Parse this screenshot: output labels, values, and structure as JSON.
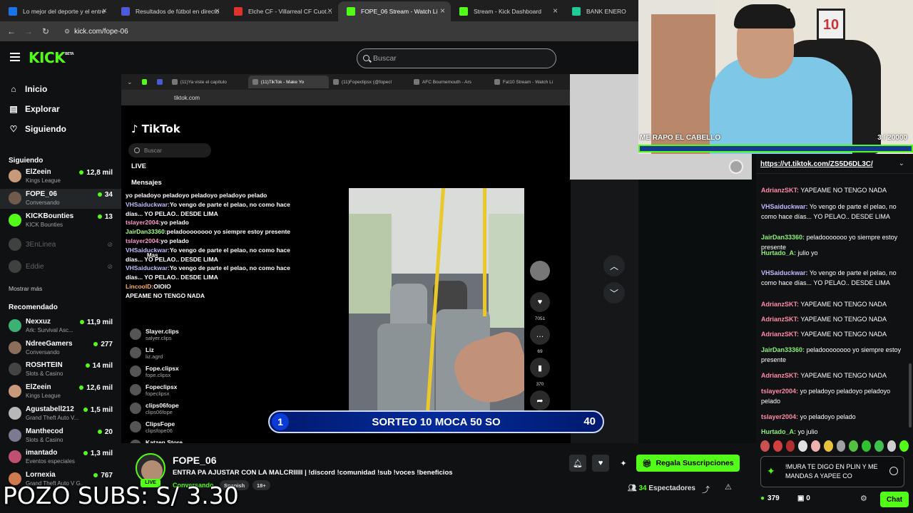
{
  "browser_tabs": [
    {
      "label": "Lo mejor del deporte y el entre",
      "color": "#1a73e8"
    },
    {
      "label": "Resultados de fútbol en directo",
      "color": "#4a5bd4"
    },
    {
      "label": "Elche CF - Villarreal CF Cuotas",
      "color": "#e03131"
    },
    {
      "label": "FOPE_06 Stream - Watch Li",
      "color": "#53fc18"
    },
    {
      "label": "Stream - Kick Dashboard",
      "color": "#53fc18"
    },
    {
      "label": "BANK ENERO",
      "color": "#20c997"
    }
  ],
  "address": "kick.com/fope-06",
  "kick": {
    "logo": "KICK",
    "beta": "BETA",
    "search_placeholder": "Buscar"
  },
  "nav": [
    {
      "label": "Inicio",
      "icon": "home-icon",
      "glyph": "⌂"
    },
    {
      "label": "Explorar",
      "icon": "browse-icon",
      "glyph": "▤"
    },
    {
      "label": "Siguiendo",
      "icon": "heart-icon",
      "glyph": "♡"
    }
  ],
  "following_heading": "Siguiendo",
  "following": [
    {
      "name": "ElZeein",
      "category": "Kings League",
      "viewers": "12,8 mil",
      "color": "#c79a7b"
    },
    {
      "name": "FOPE_06",
      "category": "Conversando",
      "viewers": "34",
      "color": "#6f5a4b"
    },
    {
      "name": "KICKBounties",
      "category": "KICK Bounties",
      "viewers": "13",
      "color": "#53fc18"
    }
  ],
  "offline": [
    {
      "name": "3EnLinea"
    },
    {
      "name": "Eddie"
    }
  ],
  "show_more": "Mostrar más",
  "recommended_heading": "Recomendado",
  "recommended": [
    {
      "name": "Nexxuz",
      "category": "Ark: Survival Asc...",
      "viewers": "11,9 mil",
      "color": "#3bb273"
    },
    {
      "name": "NdreeGamers",
      "category": "Conversando",
      "viewers": "277",
      "color": "#8a6d5a"
    },
    {
      "name": "ROSHTEIN",
      "category": "Slots & Casino",
      "viewers": "14 mil",
      "color": "#444"
    },
    {
      "name": "ElZeein",
      "category": "Kings League",
      "viewers": "12,6 mil",
      "color": "#c79a7b"
    },
    {
      "name": "Agustabell212",
      "category": "Grand Theft Auto V...",
      "viewers": "1,5 mil",
      "color": "#b8b8b8"
    },
    {
      "name": "Manthecod",
      "category": "Slots & Casino",
      "viewers": "20",
      "color": "#7a7a90"
    },
    {
      "name": "imantado",
      "category": "Eventos especiales",
      "viewers": "1,3 mil",
      "color": "#c05070"
    },
    {
      "name": "Lornexia",
      "category": "Grand Theft Auto V G...",
      "viewers": "767",
      "color": "#d07a50"
    }
  ],
  "inner_browser": {
    "tabs": [
      "(11)Ya viste el capítulo",
      "(11)TikTok - Make Yo",
      "(11)Fopeclipsx (@fopecl",
      "AFC Bournemouth - Ars",
      "Fat10 Stream - Watch Li"
    ],
    "address": "tiktok.com"
  },
  "tiktok": {
    "logo": "TikTok",
    "search_placeholder": "Buscar",
    "menu": [
      "LIVE",
      "Mensajes",
      "Mas"
    ],
    "accounts": [
      {
        "name": "Slayer.clips",
        "user": "salyer.clips"
      },
      {
        "name": "Liz",
        "user": "liz.agrd"
      },
      {
        "name": "Fope.clipsx",
        "user": "fope.clipsx"
      },
      {
        "name": "Fopeclipsx",
        "user": "fopeclipsx"
      },
      {
        "name": "clips06fope",
        "user": "clips06fope"
      },
      {
        "name": "ClipsFope",
        "user": "clipsfope06"
      },
      {
        "name": "Katzen Store",
        "user": ""
      }
    ],
    "counts": [
      "7051",
      "69",
      "370",
      "1422"
    ]
  },
  "overlay_chat": [
    {
      "user": "",
      "text": "yo peladoyo peladoyo peladoyo peladoyo pelado",
      "cls": "u1"
    },
    {
      "user": "VHSaiduckwar:",
      "text": "Yo vengo de parte el pelao, no como hace días... YO PELAO.. DESDE LIMA",
      "cls": "u2"
    },
    {
      "user": "tslayer2004:",
      "text": "yo pelado",
      "cls": "u1"
    },
    {
      "user": "JairDan33360:",
      "text": "peladoooooooo yo siempre estoy presente",
      "cls": "u3"
    },
    {
      "user": "tslayer2004:",
      "text": "yo pelado",
      "cls": "u1"
    },
    {
      "user": "VHSaiduckwar:",
      "text": "Yo vengo de parte el pelao, no como hace días... YO PELAO.. DESDE LIMA",
      "cls": "u2"
    },
    {
      "user": "VHSaiduckwar:",
      "text": "Yo vengo de parte el pelao, no como hace días... YO PELAO.. DESDE LIMA",
      "cls": "u2"
    },
    {
      "user": "LincoolD:",
      "text": "OIOIO",
      "cls": "u4"
    },
    {
      "user": "",
      "text": "APEAME NO TENGO NADA",
      "cls": ""
    }
  ],
  "sorteo": {
    "left": "1",
    "text": "SORTEO 10 MOCA 50 SO",
    "right": "40"
  },
  "webcam": {
    "label": "ME RAPO EL CABELLO",
    "goal": "3 / 20000",
    "progress": 0.00015,
    "frame_text": "10"
  },
  "chat": {
    "pinned_link": "https://vt.tiktok.com/ZS5D6DL3C/",
    "messages": [
      {
        "user": "AdrianzSKT:",
        "text": "YAPEAME NO TENGO NADA",
        "color": "#ff8aa8"
      },
      {
        "user": "VHSaiduckwar:",
        "text": "Yo vengo de parte el pelao, no como hace días... YO PELAO.. DESDE LIMA",
        "color": "#c6b8ff"
      },
      {
        "user": "JairDan33360:",
        "text": "peladooooooo yo siempre estoy presente",
        "color": "#8df07a"
      },
      {
        "user": "Hurtado_A:",
        "text": "julio yo",
        "color": "#8df07a"
      },
      {
        "user": "VHSaiduckwar:",
        "text": "Yo vengo de parte el pelao, no como hace días... YO PELAO.. DESDE LIMA",
        "color": "#c6b8ff"
      },
      {
        "user": "AdrianzSKT:",
        "text": "YAPEAME NO TENGO NADA",
        "color": "#ff8aa8"
      },
      {
        "user": "AdrianzSKT:",
        "text": "YAPEAME NO TENGO NADA",
        "color": "#ff8aa8"
      },
      {
        "user": "AdrianzSKT:",
        "text": "YAPEAME NO TENGO NADA",
        "color": "#ff8aa8"
      },
      {
        "user": "JairDan33360:",
        "text": "peladoooooooo yo siempre estoy presente",
        "color": "#8df07a"
      },
      {
        "user": "AdrianzSKT:",
        "text": "YAPEAME NO TENGO NADA",
        "color": "#ff8aa8"
      },
      {
        "user": "tslayer2004:",
        "text": "yo peladoyo peladoyo peladoyo pelado",
        "color": "#ff8aa8"
      },
      {
        "user": "tslayer2004:",
        "text": "yo peladoyo pelado",
        "color": "#ff8aa8"
      },
      {
        "user": "Hurtado_A:",
        "text": "yo julio",
        "color": "#8df07a"
      }
    ],
    "input_text": "!MURA TE DIGO EN PLIN Y ME MANDAS A YAPEE CO",
    "points": "379",
    "drops": "0",
    "send_label": "Chat"
  },
  "stream": {
    "name": "FOPE_06",
    "title": "ENTRA PA AJUSTAR CON LA MALCRIIIII | !discord !comunidad !sub !voces !beneficios",
    "category": "Conversando",
    "tags": [
      "Spanish",
      "18+"
    ],
    "live_label": "LIVE",
    "subscribe_label": "Regala Suscripciones",
    "viewers": "34",
    "viewers_label": "Espectadores"
  },
  "pozo_overlay": "POZO SUBS: S/ 3.30",
  "colors": {
    "accent": "#53fc18",
    "background": "#0f1112"
  }
}
